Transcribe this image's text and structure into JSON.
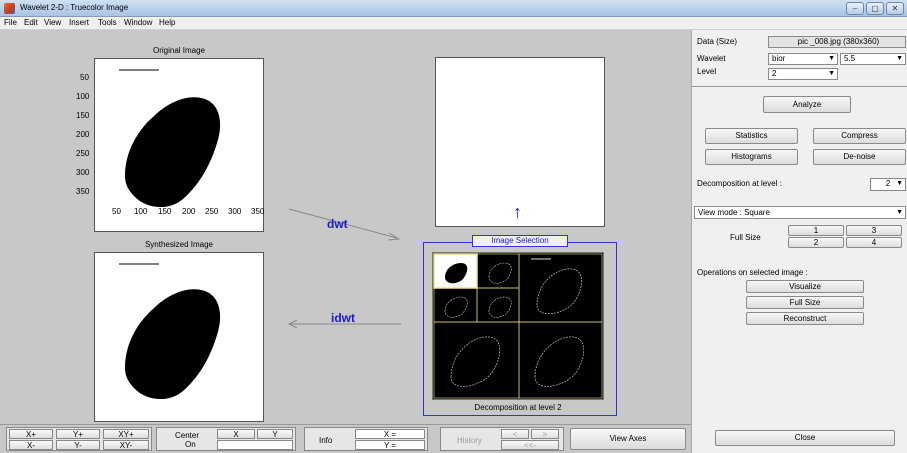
{
  "window": {
    "title": "Wavelet 2-D : Truecolor Image",
    "min_glyph": "–",
    "max_glyph": "▢",
    "close_glyph": "✕"
  },
  "menu": [
    "File",
    "Edit",
    "View",
    "Insert",
    "Tools",
    "Window",
    "Help"
  ],
  "original": {
    "title": "Original Image",
    "yticks": [
      "50",
      "100",
      "150",
      "200",
      "250",
      "300",
      "350"
    ],
    "xticks": [
      "50",
      "100",
      "150",
      "200",
      "250",
      "300",
      "350"
    ]
  },
  "synth": {
    "title": "Synthesized Image"
  },
  "arrows": {
    "dwt": "dwt",
    "idwt": "idwt",
    "up": "↑"
  },
  "selection": {
    "label": "Image Selection",
    "caption": "Decomposition at level 2"
  },
  "panel": {
    "data_label": "Data  (Size)",
    "data_value": "pic _008.jpg  (380x360)",
    "wavelet_label": "Wavelet",
    "wavelet_family": "bior",
    "wavelet_order": "5.5",
    "level_label": "Level",
    "level_value": "2",
    "analyze": "Analyze",
    "statistics": "Statistics",
    "compress": "Compress",
    "histograms": "Histograms",
    "denoise": "De-noise",
    "decomp_label": "Decomposition at level :",
    "decomp_value": "2",
    "viewmode": "View mode : Square",
    "fullsize_label": "Full Size",
    "fs1": "1",
    "fs2": "2",
    "fs3": "3",
    "fs4": "4",
    "ops_label": "Operations on selected image :",
    "visualize": "Visualize",
    "fullsize": "Full Size",
    "reconstruct": "Reconstruct",
    "close": "Close"
  },
  "bottom": {
    "xplus": "X+",
    "yplus": "Y+",
    "xyplus": "XY+",
    "xminus": "X-",
    "yminus": "Y-",
    "xyminus": "XY-",
    "center": "Center",
    "on": "On",
    "x": "X",
    "y": "Y",
    "info": "Info",
    "xeq": "X =",
    "yeq": "Y =",
    "history": "History",
    "lt": "<",
    "gt": ">",
    "ltlt": "<<-",
    "viewaxes": "View Axes"
  },
  "dd_glyph": "▼"
}
